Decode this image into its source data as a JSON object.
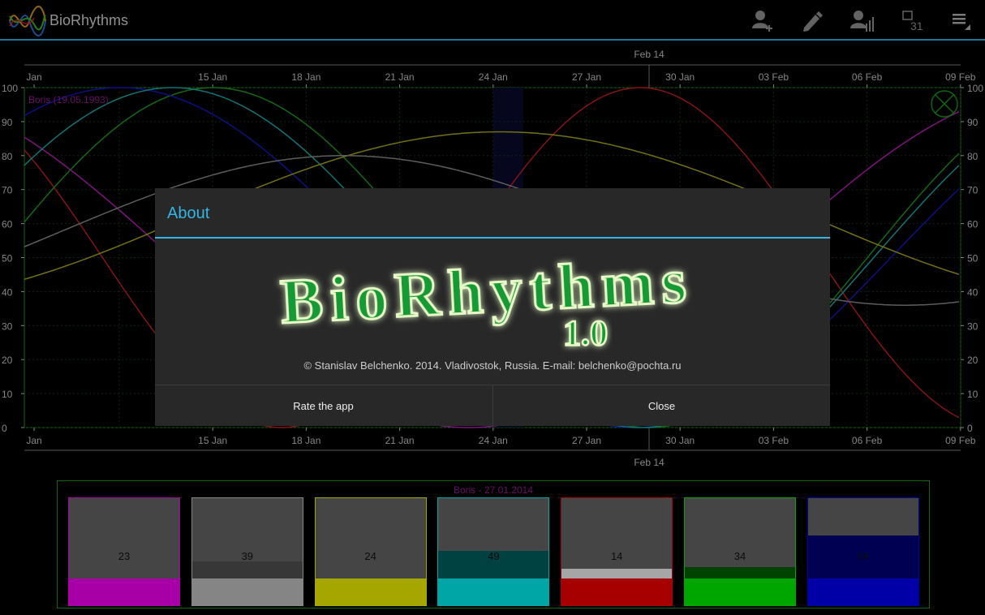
{
  "app": {
    "title": "BioRhythms"
  },
  "actions": {
    "add_person": "add-person-icon",
    "edit": "edit-pencil-icon",
    "compare": "person-stats-icon",
    "calendar_day": "31",
    "menu": "overflow-menu-icon"
  },
  "chart_data": {
    "type": "line",
    "top_axis_label": "Feb 14",
    "bottom_axis_label": "Feb 14",
    "x_ticks": [
      "Jan",
      "15 Jan",
      "18 Jan",
      "21 Jan",
      "24 Jan",
      "27 Jan",
      "30 Jan",
      "03 Feb",
      "06 Feb",
      "09 Feb"
    ],
    "y_ticks": [
      0,
      10,
      20,
      30,
      40,
      50,
      60,
      70,
      80,
      90,
      100
    ],
    "ylim": [
      0,
      100
    ],
    "person_label": "Boris (19.05.1993)",
    "grid": true,
    "series": [
      {
        "color": "#cc2020",
        "period": 23,
        "amp": 50,
        "offset": 50,
        "peak_day": 19.5
      },
      {
        "color": "#20a020",
        "period": 28,
        "amp": 50,
        "offset": 50,
        "peak_day": 5.8
      },
      {
        "color": "#1818c8",
        "period": 33,
        "amp": 50,
        "offset": 50,
        "peak_day": 2.8
      },
      {
        "color": "#c020c0",
        "period": 38,
        "amp": 50,
        "offset": 50,
        "peak_day": -5
      },
      {
        "color": "#20b0b0",
        "period": 30,
        "amp": 50,
        "offset": 50,
        "peak_day": 4.5
      },
      {
        "color": "#b0b020",
        "period": 40,
        "amp": 25,
        "offset": 62,
        "peak_day": 15
      },
      {
        "color": "#909090",
        "period": 36,
        "amp": 22,
        "offset": 58,
        "peak_day": 10
      }
    ]
  },
  "panel": {
    "title": "Boris - 27.01.2014",
    "bars": [
      {
        "value": "23",
        "fill": 0,
        "color": "#ff00ff"
      },
      {
        "value": "39",
        "fill": 0.21,
        "color": "#cccccc",
        "fill_color": "#555555"
      },
      {
        "value": "24",
        "fill": 0,
        "color": "#ffff00"
      },
      {
        "value": "49",
        "fill": 0.34,
        "color": "#00ffff",
        "fill_color": "#006666"
      },
      {
        "value": "14",
        "fill": 0.12,
        "color": "#ff0000",
        "fill_color": "#ffffff"
      },
      {
        "value": "34",
        "fill": 0.14,
        "color": "#00ff00",
        "fill_color": "#006600"
      },
      {
        "value": "64",
        "fill": 0.53,
        "color": "#0000ff",
        "fill_color": "#000080"
      }
    ]
  },
  "dialog": {
    "title": "About",
    "logo_text": "BioRhythms",
    "version": "1.0",
    "copyright": "© Stanislav Belchenko. 2014. Vladivostok, Russia. E-mail: belchenko@pochta.ru",
    "rate_label": "Rate the app",
    "close_label": "Close"
  }
}
